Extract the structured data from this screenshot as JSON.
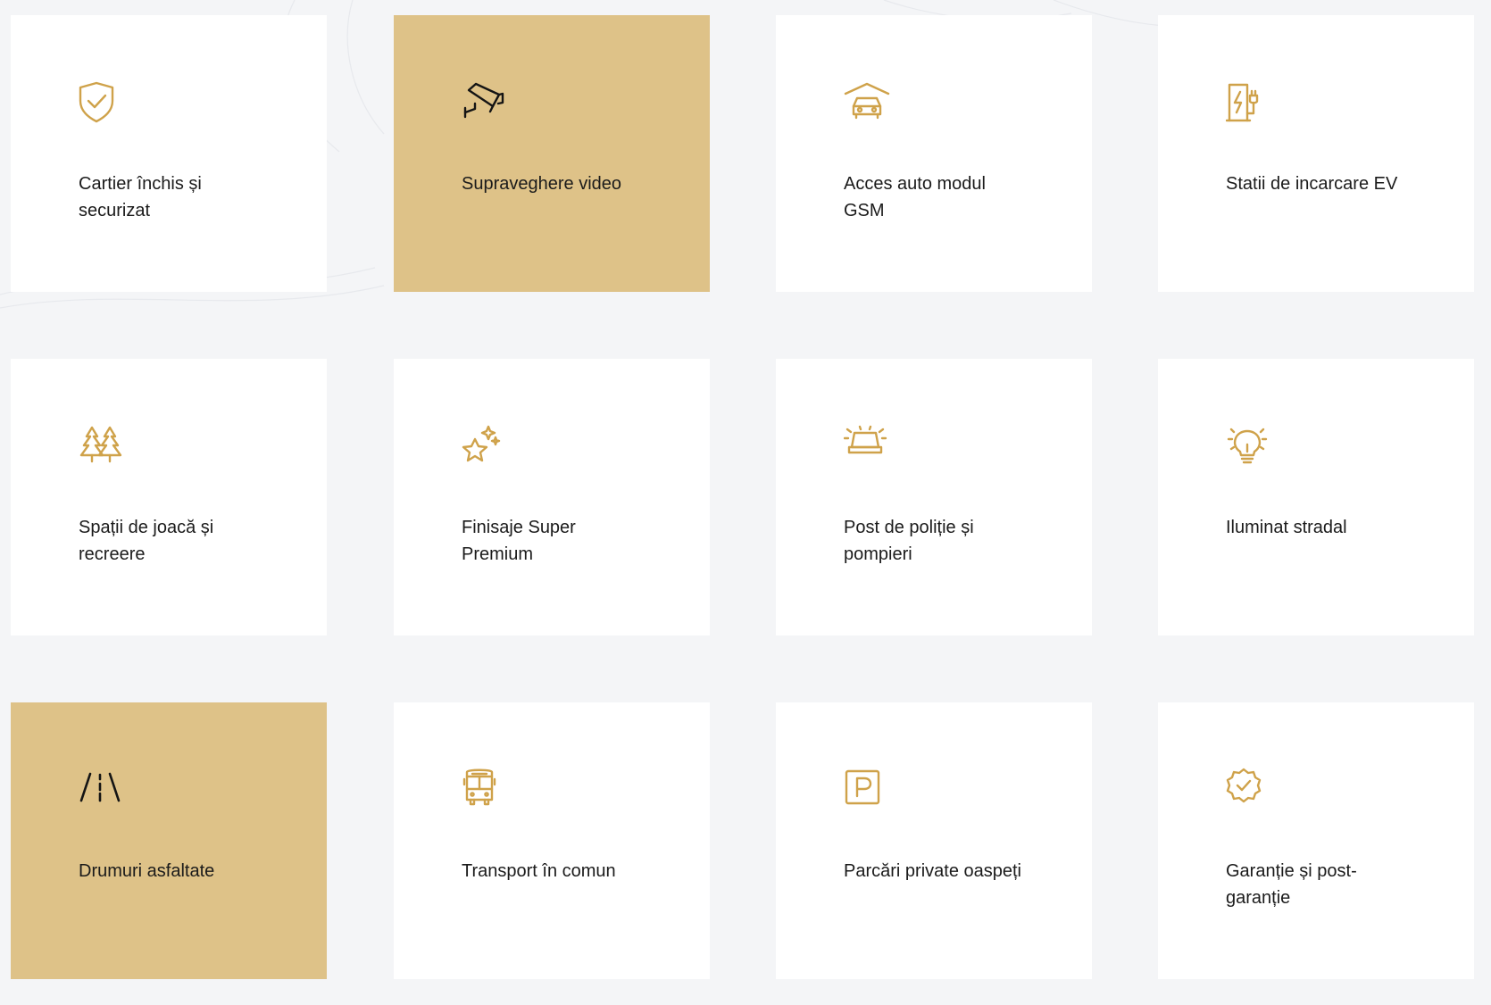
{
  "colors": {
    "page_background": "#f4f5f7",
    "card_background": "#ffffff",
    "card_highlight": "#dec288",
    "icon_gold": "#cfa24a",
    "text": "#1b1b1b"
  },
  "features": [
    {
      "label": "Cartier închis și securizat",
      "icon": "shield-check-icon",
      "highlighted": false
    },
    {
      "label": "Supraveghere video",
      "icon": "security-camera-icon",
      "highlighted": true
    },
    {
      "label": "Acces auto modul GSM",
      "icon": "car-garage-icon",
      "highlighted": false
    },
    {
      "label": "Statii de incarcare EV",
      "icon": "ev-charger-icon",
      "highlighted": false
    },
    {
      "label": "Spații de joacă și recreere",
      "icon": "pine-trees-icon",
      "highlighted": false
    },
    {
      "label": "Finisaje Super Premium",
      "icon": "star-sparkle-icon",
      "highlighted": false
    },
    {
      "label": "Post de poliție și pompieri",
      "icon": "siren-light-icon",
      "highlighted": false
    },
    {
      "label": "Iluminat stradal",
      "icon": "lightbulb-icon",
      "highlighted": false
    },
    {
      "label": "Drumuri asfaltate",
      "icon": "road-icon",
      "highlighted": true
    },
    {
      "label": "Transport în comun",
      "icon": "bus-icon",
      "highlighted": false
    },
    {
      "label": "Parcări private oaspeți",
      "icon": "parking-icon",
      "highlighted": false
    },
    {
      "label": "Garanție și post-garanție",
      "icon": "badge-check-icon",
      "highlighted": false
    }
  ]
}
